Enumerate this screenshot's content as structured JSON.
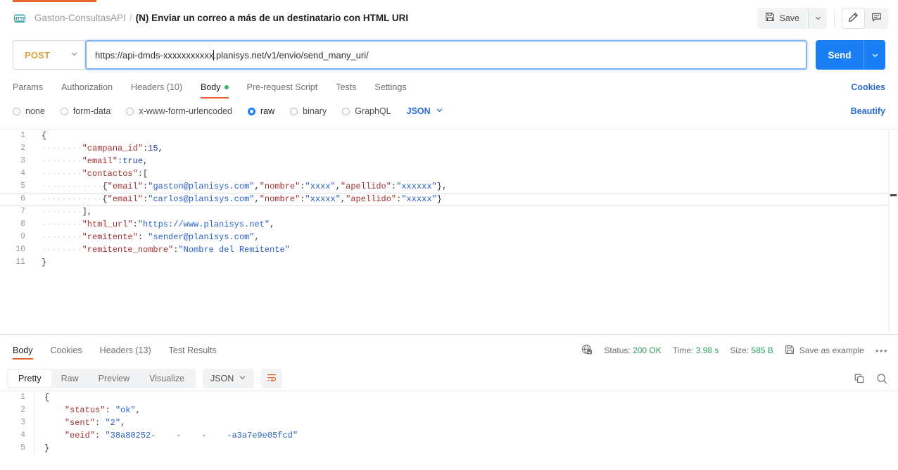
{
  "header": {
    "protocol_icon": "http-badge-icon",
    "collection_name": "Gaston-ConsultasAPI",
    "separator": "/",
    "request_name": "(N) Enviar un correo a más de un destinatario con HTML URI",
    "save_label": "Save",
    "save_icon": "floppy-disk-icon",
    "save_caret_icon": "chevron-down-icon",
    "edit_icon": "pencil-icon",
    "comment_icon": "comment-icon"
  },
  "url_bar": {
    "method": "POST",
    "method_caret_icon": "chevron-down-icon",
    "url_before_caret": "https://api-dmds-xxxxxxxxxxx",
    "url_after_caret": ".planisys.net/v1/envio/send_many_uri/",
    "url_full": "https://api-dmds-xxxxxxxxxxx.planisys.net/v1/envio/send_many_uri/",
    "send_label": "Send",
    "send_caret_icon": "chevron-down-icon"
  },
  "request_tabs": {
    "items": [
      {
        "label": "Params",
        "active": false
      },
      {
        "label": "Authorization",
        "active": false
      },
      {
        "label": "Headers (10)",
        "active": false
      },
      {
        "label": "Body",
        "active": true,
        "dot": true
      },
      {
        "label": "Pre-request Script",
        "active": false
      },
      {
        "label": "Tests",
        "active": false
      },
      {
        "label": "Settings",
        "active": false
      }
    ],
    "cookies_link": "Cookies"
  },
  "body_options": {
    "items": [
      {
        "label": "none",
        "selected": false
      },
      {
        "label": "form-data",
        "selected": false
      },
      {
        "label": "x-www-form-urlencoded",
        "selected": false
      },
      {
        "label": "raw",
        "selected": true
      },
      {
        "label": "binary",
        "selected": false
      },
      {
        "label": "GraphQL",
        "selected": false
      }
    ],
    "format": "JSON",
    "format_caret_icon": "chevron-down-icon",
    "beautify_link": "Beautify"
  },
  "request_body": {
    "lines": [
      {
        "no": "1",
        "current": false,
        "tokens": [
          {
            "c": "p",
            "t": "{"
          }
        ]
      },
      {
        "no": "2",
        "current": false,
        "tokens": [
          {
            "c": "ws",
            "t": "········"
          },
          {
            "c": "k",
            "t": "\"campana_id\""
          },
          {
            "c": "p",
            "t": ":"
          },
          {
            "c": "n",
            "t": "15"
          },
          {
            "c": "p",
            "t": ","
          }
        ]
      },
      {
        "no": "3",
        "current": false,
        "tokens": [
          {
            "c": "ws",
            "t": "········"
          },
          {
            "c": "k",
            "t": "\"email\""
          },
          {
            "c": "p",
            "t": ":"
          },
          {
            "c": "n",
            "t": "true"
          },
          {
            "c": "p",
            "t": ","
          }
        ]
      },
      {
        "no": "4",
        "current": false,
        "tokens": [
          {
            "c": "ws",
            "t": "········"
          },
          {
            "c": "k",
            "t": "\"contactos\""
          },
          {
            "c": "p",
            "t": ":["
          }
        ]
      },
      {
        "no": "5",
        "current": false,
        "tokens": [
          {
            "c": "ws",
            "t": "············"
          },
          {
            "c": "p",
            "t": "{"
          },
          {
            "c": "k",
            "t": "\"email\""
          },
          {
            "c": "p",
            "t": ":"
          },
          {
            "c": "s",
            "t": "\"gaston@planisys.com\""
          },
          {
            "c": "p",
            "t": ","
          },
          {
            "c": "k",
            "t": "\"nombre\""
          },
          {
            "c": "p",
            "t": ":"
          },
          {
            "c": "s",
            "t": "\"xxxx\""
          },
          {
            "c": "p",
            "t": ","
          },
          {
            "c": "k",
            "t": "\"apellido\""
          },
          {
            "c": "p",
            "t": ":"
          },
          {
            "c": "s",
            "t": "\"xxxxxx\""
          },
          {
            "c": "p",
            "t": "},"
          }
        ]
      },
      {
        "no": "6",
        "current": true,
        "tokens": [
          {
            "c": "ws",
            "t": "············"
          },
          {
            "c": "p",
            "t": "{"
          },
          {
            "c": "k",
            "t": "\"email\""
          },
          {
            "c": "p",
            "t": ":"
          },
          {
            "c": "s",
            "t": "\"carlos@planisys.com\""
          },
          {
            "c": "p",
            "t": ","
          },
          {
            "c": "k",
            "t": "\"nombre\""
          },
          {
            "c": "p",
            "t": ":"
          },
          {
            "c": "s",
            "t": "\"xxxxx\""
          },
          {
            "c": "p",
            "t": ","
          },
          {
            "c": "k",
            "t": "\"apellido\""
          },
          {
            "c": "p",
            "t": ":"
          },
          {
            "c": "s",
            "t": "\"xxxxx\""
          },
          {
            "c": "p",
            "t": "}"
          }
        ]
      },
      {
        "no": "7",
        "current": false,
        "tokens": [
          {
            "c": "ws",
            "t": "········"
          },
          {
            "c": "p",
            "t": "],"
          }
        ]
      },
      {
        "no": "8",
        "current": false,
        "tokens": [
          {
            "c": "ws",
            "t": "········"
          },
          {
            "c": "k",
            "t": "\"html_url\""
          },
          {
            "c": "p",
            "t": ":"
          },
          {
            "c": "s",
            "t": "\"https://www.planisys.net\""
          },
          {
            "c": "p",
            "t": ","
          }
        ]
      },
      {
        "no": "9",
        "current": false,
        "tokens": [
          {
            "c": "ws",
            "t": "········"
          },
          {
            "c": "k",
            "t": "\"remitente\""
          },
          {
            "c": "p",
            "t": ": "
          },
          {
            "c": "s",
            "t": "\"sender@planisys.com\""
          },
          {
            "c": "p",
            "t": ","
          }
        ]
      },
      {
        "no": "10",
        "current": false,
        "tokens": [
          {
            "c": "ws",
            "t": "········"
          },
          {
            "c": "k",
            "t": "\"remitente_nombre\""
          },
          {
            "c": "p",
            "t": ":"
          },
          {
            "c": "s",
            "t": "\"Nombre del Remitente\""
          }
        ]
      },
      {
        "no": "11",
        "current": false,
        "tokens": [
          {
            "c": "p",
            "t": "}"
          }
        ]
      }
    ]
  },
  "response_tabs": {
    "items": [
      {
        "label": "Body",
        "active": true
      },
      {
        "label": "Cookies",
        "active": false
      },
      {
        "label": "Headers (13)",
        "active": false
      },
      {
        "label": "Test Results",
        "active": false
      }
    ],
    "network_icon": "globe-lock-icon",
    "status_label": "Status:",
    "status_value": "200 OK",
    "time_label": "Time:",
    "time_value": "3.98 s",
    "size_label": "Size:",
    "size_value": "585 B",
    "save_example_icon": "floppy-disk-icon",
    "save_example_label": "Save as example",
    "more_icon": "ellipsis-icon"
  },
  "response_toolbar": {
    "views": [
      {
        "label": "Pretty",
        "active": true
      },
      {
        "label": "Raw",
        "active": false
      },
      {
        "label": "Preview",
        "active": false
      },
      {
        "label": "Visualize",
        "active": false
      }
    ],
    "format": "JSON",
    "format_caret_icon": "chevron-down-icon",
    "wrap_icon": "word-wrap-icon",
    "copy_icon": "copy-icon",
    "search_icon": "search-icon"
  },
  "response_body": {
    "lines": [
      {
        "no": "1",
        "tokens": [
          {
            "c": "p",
            "t": "{"
          }
        ]
      },
      {
        "no": "2",
        "tokens": [
          {
            "c": "p",
            "t": "    "
          },
          {
            "c": "k",
            "t": "\"status\""
          },
          {
            "c": "p",
            "t": ": "
          },
          {
            "c": "s",
            "t": "\"ok\""
          },
          {
            "c": "p",
            "t": ","
          }
        ]
      },
      {
        "no": "3",
        "tokens": [
          {
            "c": "p",
            "t": "    "
          },
          {
            "c": "k",
            "t": "\"sent\""
          },
          {
            "c": "p",
            "t": ": "
          },
          {
            "c": "s",
            "t": "\"2\""
          },
          {
            "c": "p",
            "t": ","
          }
        ]
      },
      {
        "no": "4",
        "tokens": [
          {
            "c": "p",
            "t": "    "
          },
          {
            "c": "k",
            "t": "\"eeid\""
          },
          {
            "c": "p",
            "t": ": "
          },
          {
            "c": "s",
            "t": "\"38a80252-    -    -    -a3a7e9e05fcd\""
          }
        ]
      },
      {
        "no": "5",
        "tokens": [
          {
            "c": "p",
            "t": "}"
          }
        ]
      }
    ]
  },
  "colors": {
    "accent_orange": "#e8622b",
    "send_blue": "#1a7ef4",
    "link_blue": "#2b6cd4",
    "status_green": "#2f9e5c",
    "method_yellow": "#d9a43c"
  }
}
